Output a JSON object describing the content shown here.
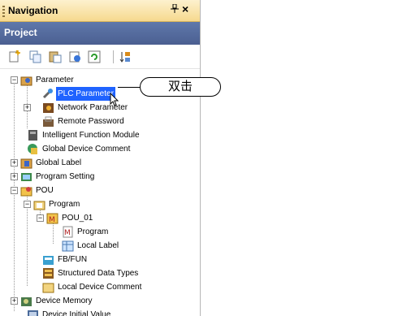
{
  "navigation": {
    "title": "Navigation",
    "pin_glyph": "⊥",
    "close_glyph": "×"
  },
  "project": {
    "label": "Project"
  },
  "toolbar": {
    "buttons": [
      "new-item-icon",
      "copy-icon",
      "paste-icon",
      "properties-icon",
      "refresh-icon",
      "sort-icon"
    ]
  },
  "tree": {
    "items": [
      {
        "label": "Parameter"
      },
      {
        "label": "PLC Parameter"
      },
      {
        "label": "Network Parameter"
      },
      {
        "label": "Remote Password"
      },
      {
        "label": "Intelligent Function Module"
      },
      {
        "label": "Global Device Comment"
      },
      {
        "label": "Global Label"
      },
      {
        "label": "Program Setting"
      },
      {
        "label": "POU"
      },
      {
        "label": "Program"
      },
      {
        "label": "POU_01"
      },
      {
        "label": "Program"
      },
      {
        "label": "Local Label"
      },
      {
        "label": "FB/FUN"
      },
      {
        "label": "Structured Data Types"
      },
      {
        "label": "Local Device Comment"
      },
      {
        "label": "Device Memory"
      },
      {
        "label": "Device Initial Value"
      }
    ]
  },
  "callout": {
    "text": "双击"
  },
  "colors": {
    "selection": "#1f63ff",
    "project_bar": "#4b5f91",
    "titlebar": "#f6d98e"
  }
}
